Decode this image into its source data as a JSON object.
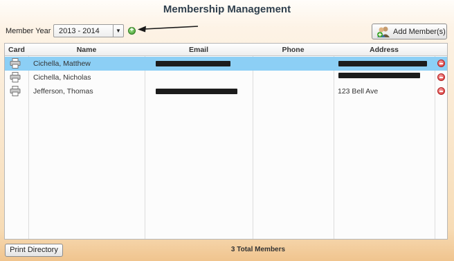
{
  "page": {
    "title": "Membership Management"
  },
  "toolbar": {
    "year_label": "Member Year",
    "year_value": "2013 - 2014",
    "add_member_label": "Add Member(s)"
  },
  "table": {
    "columns": [
      "Card",
      "Name",
      "Email",
      "Phone",
      "Address"
    ],
    "rows": [
      {
        "name": "Cichella, Matthew",
        "address": "",
        "selected": true
      },
      {
        "name": "Cichella, Nicholas",
        "address": "",
        "selected": false
      },
      {
        "name": "Jefferson, Thomas",
        "address": "123 Bell Ave",
        "selected": false
      }
    ]
  },
  "footer": {
    "print_label": "Print Directory",
    "total_text": "3 Total Members"
  },
  "icons": [
    "printer-icon",
    "remove-icon",
    "add-icon",
    "add-member-icon",
    "arrow-left-icon",
    "chevron-down-icon"
  ],
  "colors": {
    "selected_row": "#8ccff5",
    "title": "#2f3f4d",
    "remove": "#d83232",
    "add": "#3d9c2a"
  }
}
